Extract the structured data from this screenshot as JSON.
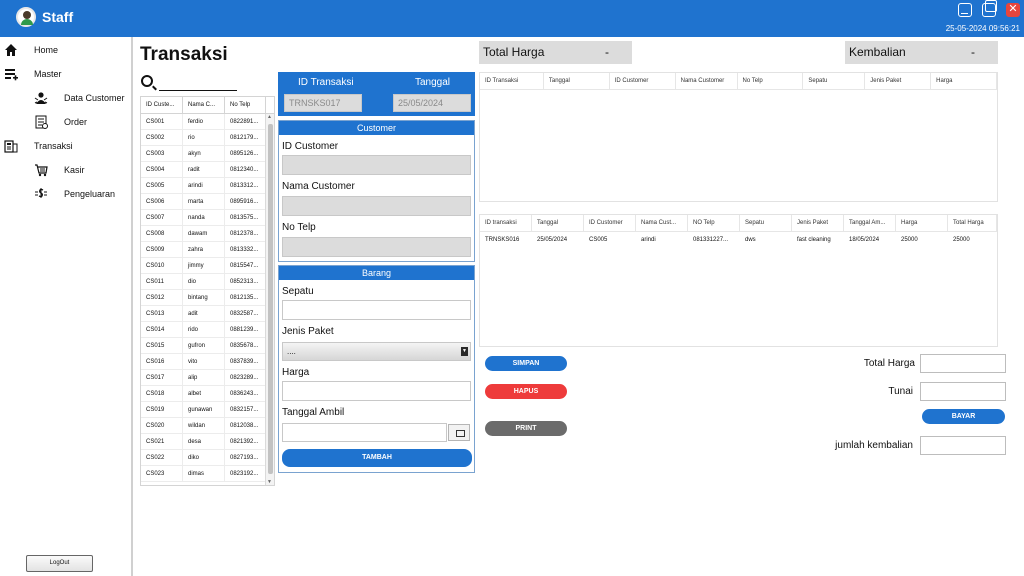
{
  "app": {
    "title": "Staff",
    "datetime": "25-05-2024  09:56:21",
    "close_glyph": "✕"
  },
  "sidebar": {
    "items": [
      {
        "label": "Home",
        "icon": "home-icon"
      },
      {
        "label": "Master",
        "icon": "list-add-icon"
      },
      {
        "label": "Data Customer",
        "icon": "customer-icon"
      },
      {
        "label": "Order",
        "icon": "order-icon"
      },
      {
        "label": "Transaksi",
        "icon": "transaction-icon"
      },
      {
        "label": "Kasir",
        "icon": "cart-icon"
      },
      {
        "label": "Pengeluaran",
        "icon": "money-out-icon"
      }
    ],
    "logout_label": "LogOut"
  },
  "page": {
    "title": "Transaksi"
  },
  "customer_table": {
    "headers": [
      "ID Custe...",
      "Nama C...",
      "No Telp"
    ],
    "rows": [
      [
        "CS001",
        "ferdio",
        "0822891..."
      ],
      [
        "CS002",
        "rio",
        "0812179..."
      ],
      [
        "CS003",
        "akyn",
        "0895126..."
      ],
      [
        "CS004",
        "radit",
        "0812340..."
      ],
      [
        "CS005",
        "arindi",
        "0813312..."
      ],
      [
        "CS006",
        "marta",
        "0895916..."
      ],
      [
        "CS007",
        "nanda",
        "0813575..."
      ],
      [
        "CS008",
        "dawam",
        "0812378..."
      ],
      [
        "CS009",
        "zahra",
        "0813332..."
      ],
      [
        "CS010",
        "jimmy",
        "0815547..."
      ],
      [
        "CS011",
        "dio",
        "0852313..."
      ],
      [
        "CS012",
        "bintang",
        "0812135..."
      ],
      [
        "CS013",
        "adit",
        "0832587..."
      ],
      [
        "CS014",
        "rido",
        "0881239..."
      ],
      [
        "CS015",
        "gufron",
        "0835678..."
      ],
      [
        "CS016",
        "vito",
        "0837839..."
      ],
      [
        "CS017",
        "alip",
        "0823289..."
      ],
      [
        "CS018",
        "albet",
        "0836243..."
      ],
      [
        "CS019",
        "gunawan",
        "0832157..."
      ],
      [
        "CS020",
        "wildan",
        "0812038..."
      ],
      [
        "CS021",
        "desa",
        "0821392..."
      ],
      [
        "CS022",
        "diko",
        "0827193..."
      ],
      [
        "CS023",
        "dimas",
        "0823192..."
      ]
    ]
  },
  "form": {
    "id_transaksi_label": "ID Transaksi",
    "tanggal_label": "Tanggal",
    "id_transaksi_value": "TRNSKS017",
    "tanggal_value": "25/05/2024",
    "customer_header": "Customer",
    "id_customer_label": "ID Customer",
    "nama_customer_label": "Nama Customer",
    "no_telp_label": "No Telp",
    "barang_header": "Barang",
    "sepatu_label": "Sepatu",
    "jenis_paket_label": "Jenis Paket",
    "jenis_paket_value": "....",
    "harga_label": "Harga",
    "tanggal_ambil_label": "Tanggal Ambil",
    "tambah_label": "TAMBAH"
  },
  "summary": {
    "total_harga_label": "Total Harga",
    "total_harga_value": "-",
    "kembalian_label": "Kembalian",
    "kembalian_value": "-"
  },
  "cart_table": {
    "headers": [
      "ID Transaksi",
      "Tanggal",
      "ID Customer",
      "Nama Customer",
      "No Telp",
      "Sepatu",
      "Jenis Paket",
      "Harga"
    ]
  },
  "history_table": {
    "headers": [
      "ID transaksi",
      "Tanggal",
      "ID Customer",
      "Nama Cust...",
      "NO Telp",
      "Sepatu",
      "Jenis Paket",
      "Tanggal Am...",
      "Harga",
      "Total Harga"
    ],
    "rows": [
      [
        "TRNSKS016",
        "25/05/2024",
        "CS005",
        "arindi",
        "081331227...",
        "dws",
        "fast cleaning",
        "18/05/2024",
        "25000",
        "25000"
      ]
    ]
  },
  "actions": {
    "simpan_label": "SIMPAN",
    "hapus_label": "HAPUS",
    "print_label": "PRINT",
    "bayar_label": "BAYAR"
  },
  "payment": {
    "total_harga_label": "Total Harga",
    "tunai_label": "Tunai",
    "jumlah_kembalian_label": "jumlah kembalian"
  },
  "colors": {
    "brand_blue": "#1f73cf",
    "danger_red": "#ee3b3b",
    "print_gray": "#6b6b6b"
  }
}
